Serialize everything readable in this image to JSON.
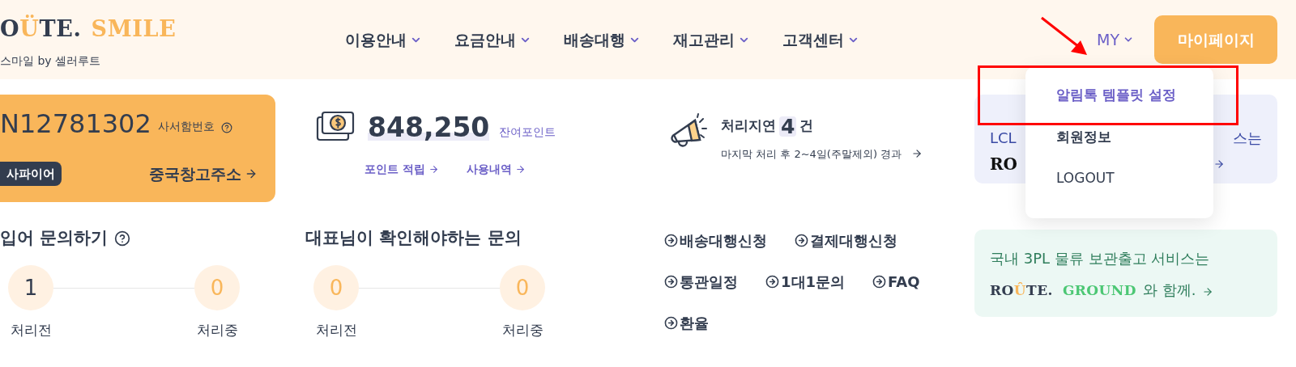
{
  "header": {
    "logo": {
      "lead": "O",
      "mark": "Ü",
      "tail": "TE.",
      "accent": "SMILE",
      "subtitle": "스마일 by 셀러루트"
    },
    "nav": [
      {
        "label": "이용안내"
      },
      {
        "label": "요금안내"
      },
      {
        "label": "배송대행"
      },
      {
        "label": "재고관리"
      },
      {
        "label": "고객센터"
      }
    ],
    "my_menu": {
      "label": "MY",
      "expanded": true
    },
    "mypage_button": "마이페이지"
  },
  "dropdown": [
    {
      "label": "알림톡 템플릿 설정",
      "selected": true
    },
    {
      "label": "회원정보",
      "selected": false
    },
    {
      "label": "LOGOUT",
      "selected": false
    }
  ],
  "address_card": {
    "number": "N12781302",
    "number_label": "사서함번호",
    "grade": "사파이어",
    "link": "중국창고주소"
  },
  "points": {
    "value": "848,250",
    "label": "잔여포인트",
    "links": [
      "포인트 적립",
      "사용내역"
    ]
  },
  "delay": {
    "title": "처리지연",
    "count": "4",
    "unit": "건",
    "note": "마지막 처리 후 2~4일(주말제외) 경과"
  },
  "inquiry_panels": [
    {
      "title": "입어 문의하기",
      "help": true,
      "steps": [
        {
          "value": "1",
          "label": "처리전",
          "active": true
        },
        {
          "value": "0",
          "label": "처리중",
          "active": false
        }
      ]
    },
    {
      "title": "대표님이 확인해야하는 문의",
      "help": false,
      "steps": [
        {
          "value": "0",
          "label": "처리전",
          "active": false
        },
        {
          "value": "0",
          "label": "처리중",
          "active": false
        }
      ]
    }
  ],
  "quick_links": [
    [
      "배송대행신청",
      "결제대행신청"
    ],
    [
      "통관일정",
      "1대1문의",
      "FAQ"
    ],
    [
      "환율"
    ]
  ],
  "banners": [
    {
      "kind": "lcl",
      "text_start": "LCL",
      "text_end": "스는",
      "logo_start": "RO"
    },
    {
      "kind": "ground",
      "text": "국내 3PL 물류 보관출고 서비스는",
      "logo": {
        "lead": "RO",
        "mark": "Û",
        "tail": "TE.",
        "accent": "GROUND"
      },
      "suffix": "와 함께."
    }
  ]
}
